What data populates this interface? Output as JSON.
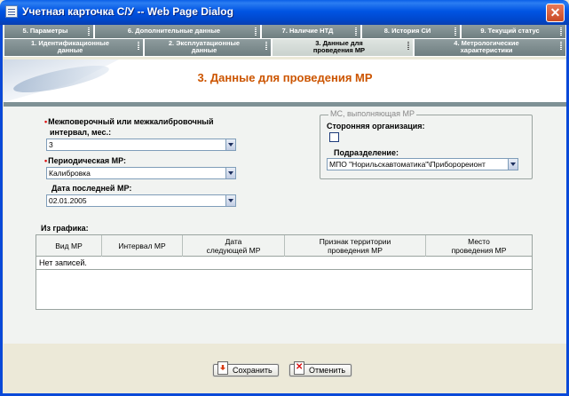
{
  "window": {
    "title": "Учетная карточка С/У -- Web Page Dialog",
    "close_label": "✕"
  },
  "tabs_top": [
    {
      "label": "5. Параметры"
    },
    {
      "label": "6. Дополнительные данные"
    },
    {
      "label": "7. Наличие НТД"
    },
    {
      "label": "8. История СИ"
    },
    {
      "label": "9. Текущий статус"
    }
  ],
  "tabs_bottom": [
    {
      "line1": "1. Идентификационные",
      "line2": "данные"
    },
    {
      "line1": "2. Эксплуатационные",
      "line2": "данные"
    },
    {
      "line1": "3. Данные для",
      "line2": "проведения МР"
    },
    {
      "line1": "4. Метрологические",
      "line2": "характеристики"
    }
  ],
  "page_heading": "3. Данные для проведения МР",
  "form": {
    "interval_label_1": "Межповерочный или межкалибровочный",
    "interval_label_2": "интервал, мес.:",
    "interval_value": "3",
    "periodic_label": "Периодическая МР:",
    "periodic_value": "Калибровка",
    "last_date_label": "Дата последней МР:",
    "last_date_value": "02.01.2005",
    "required_mark": "•"
  },
  "ms_group": {
    "legend": "МС, выполняющая МР",
    "third_party_label": "Сторонняя организация:",
    "third_party_checked": false,
    "division_label": "Подразделение:",
    "division_value": "МПО \"Норильскавтоматика\"\\Приборореионт"
  },
  "schedule": {
    "label": "Из графика:",
    "columns": [
      {
        "line1": "Вид МР",
        "line2": ""
      },
      {
        "line1": "Интервал МР",
        "line2": ""
      },
      {
        "line1": "Дата",
        "line2": "следующей МР"
      },
      {
        "line1": "Признак территории",
        "line2": "проведения МР"
      },
      {
        "line1": "Место",
        "line2": "проведения МР"
      }
    ],
    "empty_text": "Нет записей."
  },
  "buttons": {
    "save": "Сохранить",
    "cancel": "Отменить"
  }
}
